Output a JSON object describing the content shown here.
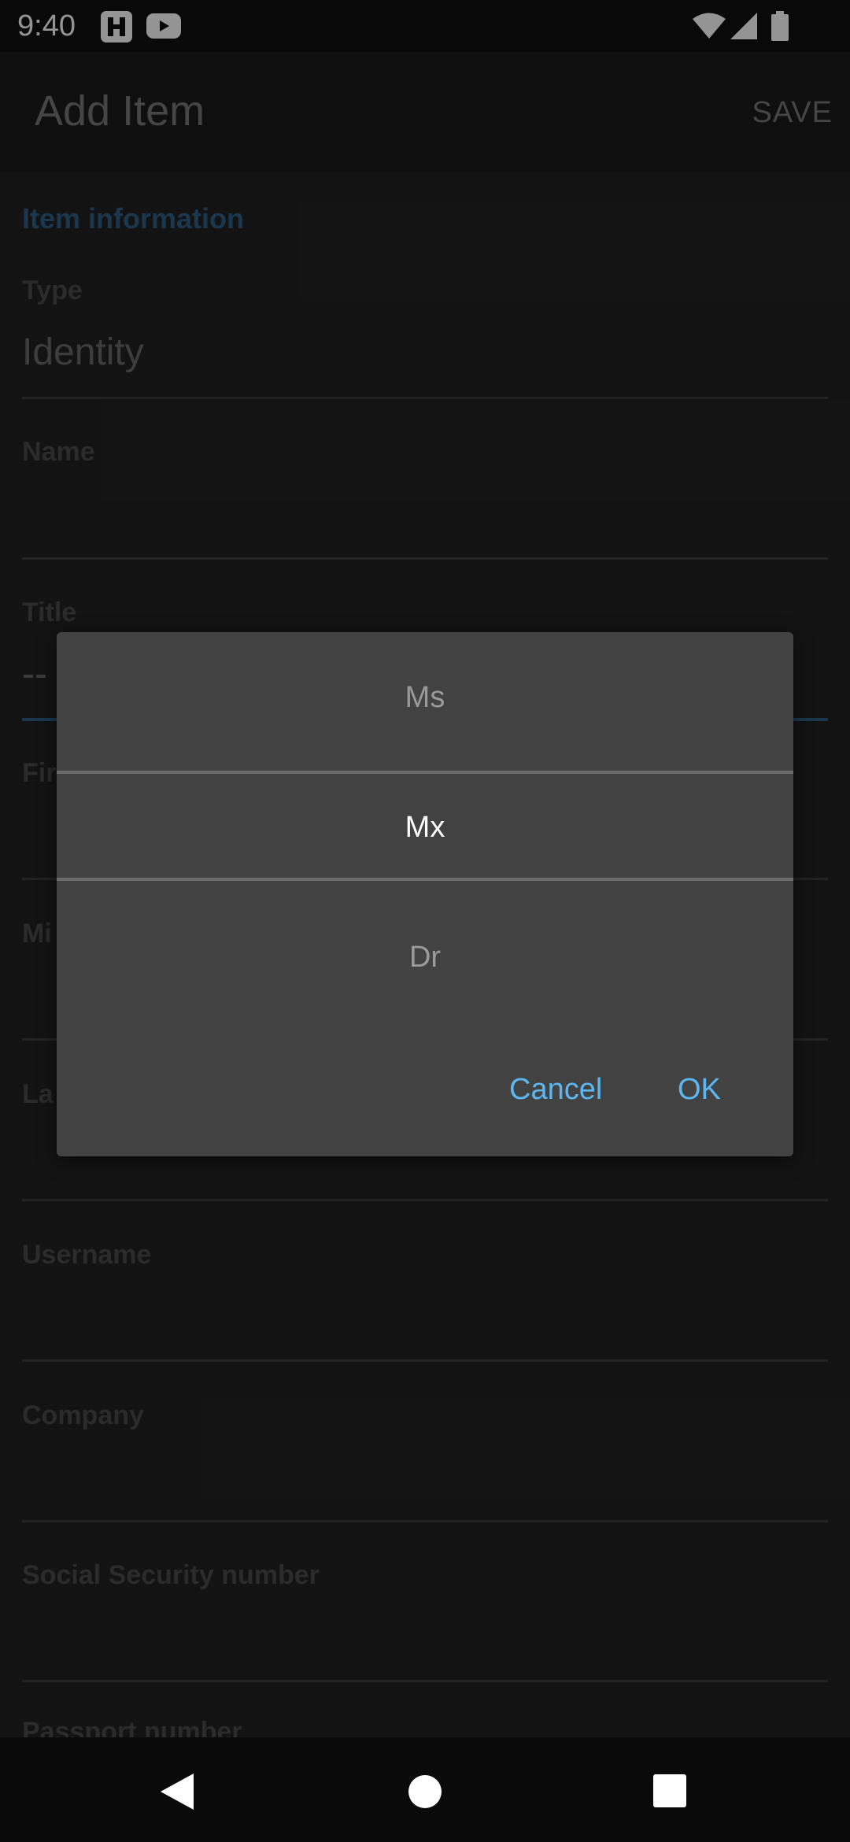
{
  "status_bar": {
    "time": "9:40",
    "icons": [
      "notification-app-icon",
      "youtube-icon",
      "wifi-icon",
      "cellular-signal-icon",
      "battery-icon"
    ]
  },
  "app_bar": {
    "title": "Add Item",
    "save_label": "SAVE"
  },
  "form": {
    "section_title": "Item information",
    "fields": [
      {
        "label": "Type",
        "value": "Identity"
      },
      {
        "label": "Name",
        "value": ""
      },
      {
        "label": "Title",
        "value": "-- S"
      },
      {
        "label": "Fir",
        "value": ""
      },
      {
        "label": "Mi",
        "value": ""
      },
      {
        "label": "La",
        "value": ""
      },
      {
        "label": "Username",
        "value": ""
      },
      {
        "label": "Company",
        "value": ""
      },
      {
        "label": "Social Security number",
        "value": ""
      },
      {
        "label": "Passport number",
        "value": ""
      }
    ]
  },
  "dialog": {
    "options": [
      "Ms",
      "Mx",
      "Dr"
    ],
    "selected": "Mx",
    "cancel_label": "Cancel",
    "ok_label": "OK"
  },
  "nav_bar": {
    "icons": [
      "back-icon",
      "home-icon",
      "recents-icon"
    ]
  },
  "colors": {
    "accent": "#5cb6ef",
    "section_header": "#2f5f86",
    "dialog_bg": "#424242",
    "background": "#222222"
  }
}
